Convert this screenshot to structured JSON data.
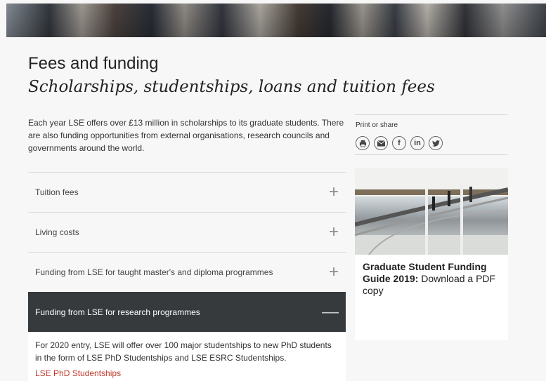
{
  "page": {
    "title": "Fees and funding",
    "subtitle": "Scholarships, studentships, loans and tuition fees",
    "intro": "Each year LSE offers over £13 million in scholarships to its graduate students. There are also funding opportunities from external organisations, research councils and governments around the world."
  },
  "accordion": {
    "items": [
      {
        "label": "Tuition fees",
        "icon": "plus-icon"
      },
      {
        "label": "Living costs",
        "icon": "plus-icon"
      },
      {
        "label": "Funding from LSE for taught master's and diploma programmes",
        "icon": "plus-icon"
      },
      {
        "label": "Funding from LSE for research programmes",
        "icon": "minus-icon"
      }
    ],
    "expanded_body": "For 2020 entry, LSE will offer over 100 major studentships to new PhD students in the form of LSE PhD Studentships and LSE ESRC Studentships.",
    "expanded_link": "LSE PhD Studentships"
  },
  "share": {
    "label": "Print or share",
    "icons": [
      "print-icon",
      "email-icon",
      "facebook-icon",
      "linkedin-icon",
      "twitter-icon"
    ]
  },
  "guide": {
    "title_bold": "Graduate Student Funding Guide 2019:",
    "title_rest": " Download a PDF copy"
  },
  "colors": {
    "active_bg": "#373a3c",
    "link": "#c0392b",
    "page_bg": "#f7f7f7"
  }
}
